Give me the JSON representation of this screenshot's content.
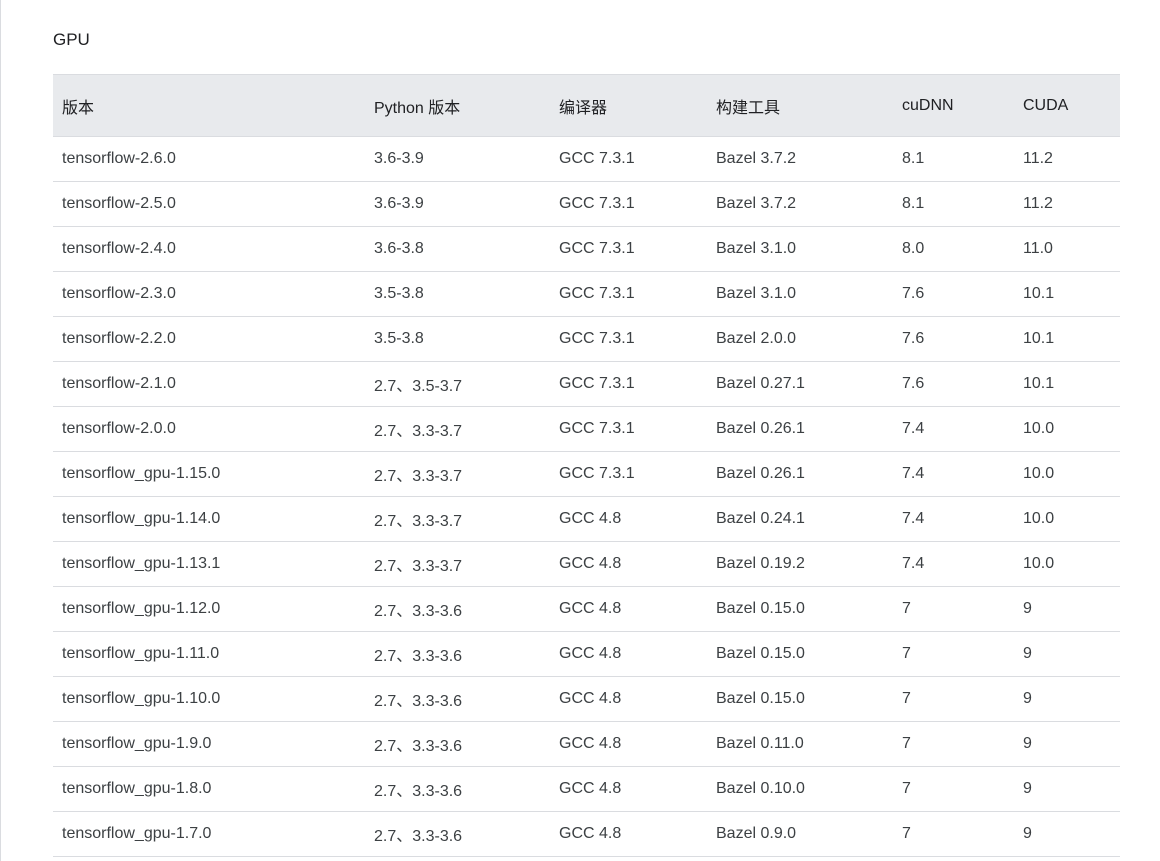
{
  "section_title": "GPU",
  "table": {
    "headers": [
      "版本",
      "Python 版本",
      "编译器",
      "构建工具",
      "cuDNN",
      "CUDA"
    ],
    "rows": [
      [
        "tensorflow-2.6.0",
        "3.6-3.9",
        "GCC 7.3.1",
        "Bazel 3.7.2",
        "8.1",
        "11.2"
      ],
      [
        "tensorflow-2.5.0",
        "3.6-3.9",
        "GCC 7.3.1",
        "Bazel 3.7.2",
        "8.1",
        "11.2"
      ],
      [
        "tensorflow-2.4.0",
        "3.6-3.8",
        "GCC 7.3.1",
        "Bazel 3.1.0",
        "8.0",
        "11.0"
      ],
      [
        "tensorflow-2.3.0",
        "3.5-3.8",
        "GCC 7.3.1",
        "Bazel 3.1.0",
        "7.6",
        "10.1"
      ],
      [
        "tensorflow-2.2.0",
        "3.5-3.8",
        "GCC 7.3.1",
        "Bazel 2.0.0",
        "7.6",
        "10.1"
      ],
      [
        "tensorflow-2.1.0",
        "2.7、3.5-3.7",
        "GCC 7.3.1",
        "Bazel 0.27.1",
        "7.6",
        "10.1"
      ],
      [
        "tensorflow-2.0.0",
        "2.7、3.3-3.7",
        "GCC 7.3.1",
        "Bazel 0.26.1",
        "7.4",
        "10.0"
      ],
      [
        "tensorflow_gpu-1.15.0",
        "2.7、3.3-3.7",
        "GCC 7.3.1",
        "Bazel 0.26.1",
        "7.4",
        "10.0"
      ],
      [
        "tensorflow_gpu-1.14.0",
        "2.7、3.3-3.7",
        "GCC 4.8",
        "Bazel 0.24.1",
        "7.4",
        "10.0"
      ],
      [
        "tensorflow_gpu-1.13.1",
        "2.7、3.3-3.7",
        "GCC 4.8",
        "Bazel 0.19.2",
        "7.4",
        "10.0"
      ],
      [
        "tensorflow_gpu-1.12.0",
        "2.7、3.3-3.6",
        "GCC 4.8",
        "Bazel 0.15.0",
        "7",
        "9"
      ],
      [
        "tensorflow_gpu-1.11.0",
        "2.7、3.3-3.6",
        "GCC 4.8",
        "Bazel 0.15.0",
        "7",
        "9"
      ],
      [
        "tensorflow_gpu-1.10.0",
        "2.7、3.3-3.6",
        "GCC 4.8",
        "Bazel 0.15.0",
        "7",
        "9"
      ],
      [
        "tensorflow_gpu-1.9.0",
        "2.7、3.3-3.6",
        "GCC 4.8",
        "Bazel 0.11.0",
        "7",
        "9"
      ],
      [
        "tensorflow_gpu-1.8.0",
        "2.7、3.3-3.6",
        "GCC 4.8",
        "Bazel 0.10.0",
        "7",
        "9"
      ],
      [
        "tensorflow_gpu-1.7.0",
        "2.7、3.3-3.6",
        "GCC 4.8",
        "Bazel 0.9.0",
        "7",
        "9"
      ]
    ]
  }
}
